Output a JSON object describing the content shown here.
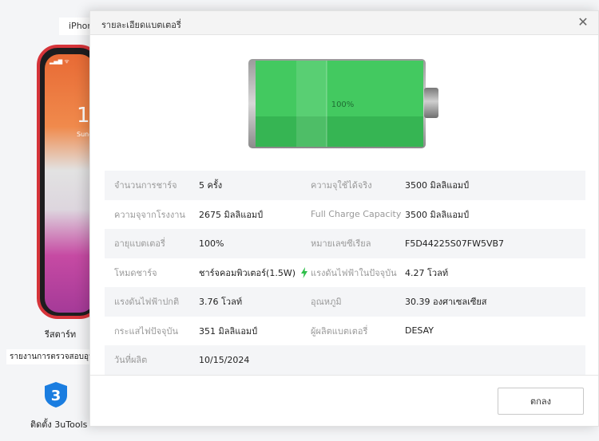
{
  "background": {
    "device_tab": "iPhone",
    "phone_time": "1",
    "phone_date": "Sund",
    "restart_label": "รีสตาร์ท",
    "report_label": "รายงานการตรวจสอบอุปก",
    "install_label": "ติดตั้ง 3uTools",
    "app_icon": "3utools-icon"
  },
  "dialog": {
    "title": "รายละเอียดแบตเตอรี่",
    "close_icon": "close-icon",
    "battery_level_text": "100%",
    "battery_level": 1.0,
    "battery_color": "#3cc05a",
    "ok_label": "ตกลง"
  },
  "rows": [
    {
      "label1": "จำนวนการชาร์จ",
      "value1": "5 ครั้ง",
      "label2": "ความจุใช้ได้จริง",
      "value2": "3500 มิลลิแอมป์"
    },
    {
      "label1": "ความจุจากโรงงาน",
      "value1": "2675 มิลลิแอมป์",
      "label2": "Full Charge Capacity",
      "value2": "3500 มิลลิแอมป์"
    },
    {
      "label1": "อายุแบตเตอรี่",
      "value1": "100%",
      "label2": "หมายเลขซีเรียล",
      "value2": "F5D44225S07FW5VB7"
    },
    {
      "label1": "โหมดชาร์จ",
      "value1": "ชาร์จคอมพิวเตอร์(1.5W)",
      "label2": "แรงดันไฟฟ้าในปัจจุบัน",
      "value2": "4.27 โวลท์",
      "icon": "lightning-icon"
    },
    {
      "label1": "แรงดันไฟฟ้าปกติ",
      "value1": "3.76 โวลท์",
      "label2": "อุณหภูมิ",
      "value2": "30.39 องศาเซลเซียส"
    },
    {
      "label1": "กระแสไฟปัจจุบัน",
      "value1": "351 มิลลิแอมป์",
      "label2": "ผู้ผลิตแบตเตอรี่",
      "value2": "DESAY"
    },
    {
      "label1": "วันที่ผลิต",
      "value1": "10/15/2024",
      "label2": "",
      "value2": ""
    }
  ]
}
